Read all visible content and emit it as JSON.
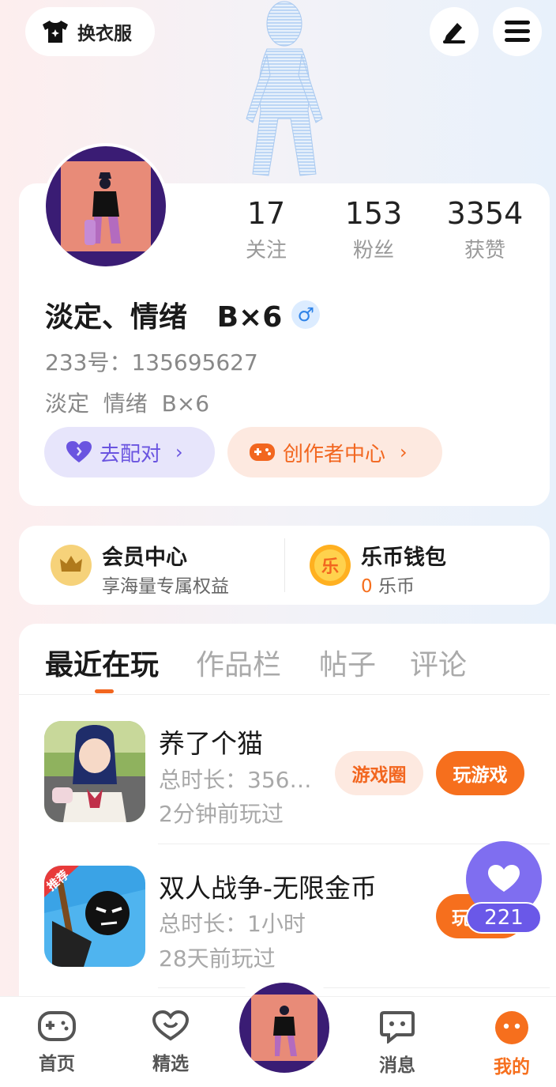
{
  "topbar": {
    "outfit_label": "换衣服",
    "edit_icon": "pen-icon",
    "menu_icon": "hamburger-menu-icon"
  },
  "profile": {
    "stats": [
      {
        "value": "17",
        "label": "关注"
      },
      {
        "value": "153",
        "label": "粉丝"
      },
      {
        "value": "3354",
        "label": "获赞"
      }
    ],
    "name": "淡定、情绪   B×6",
    "gender_symbol": "♂",
    "uid": "233号：135695627",
    "bio": "淡定  情绪  B×6",
    "match_label": "去配对",
    "creator_label": "创作者中心",
    "arrow": "›"
  },
  "member": {
    "title": "会员中心",
    "subtitle": "享海量专属权益"
  },
  "wallet": {
    "title": "乐币钱包",
    "amount": "0",
    "unit": " 乐币",
    "icon_char": "乐"
  },
  "tabs": [
    "最近在玩",
    "作品栏",
    "帖子",
    "评论"
  ],
  "games": [
    {
      "title": "养了个猫",
      "duration": "总时长：356…",
      "last_played": "2分钟前玩过",
      "circle_label": "游戏圈",
      "play_label": "玩游戏"
    },
    {
      "title": "双人战争-无限金币",
      "duration": "总时长：1小时",
      "last_played": "28天前玩过",
      "play_label": "玩",
      "badge": "推荐"
    }
  ],
  "float_like": {
    "count": "221"
  },
  "nav": [
    {
      "label": "首页",
      "icon": "gamepad-icon"
    },
    {
      "label": "精选",
      "icon": "heart-chat-icon"
    },
    {
      "label": "消息",
      "icon": "message-icon"
    },
    {
      "label": "我的",
      "icon": "me-icon"
    }
  ],
  "colors": {
    "accent": "#f66f1d",
    "purple": "#6a54e0",
    "avatar_bg": "#3a1c74"
  }
}
